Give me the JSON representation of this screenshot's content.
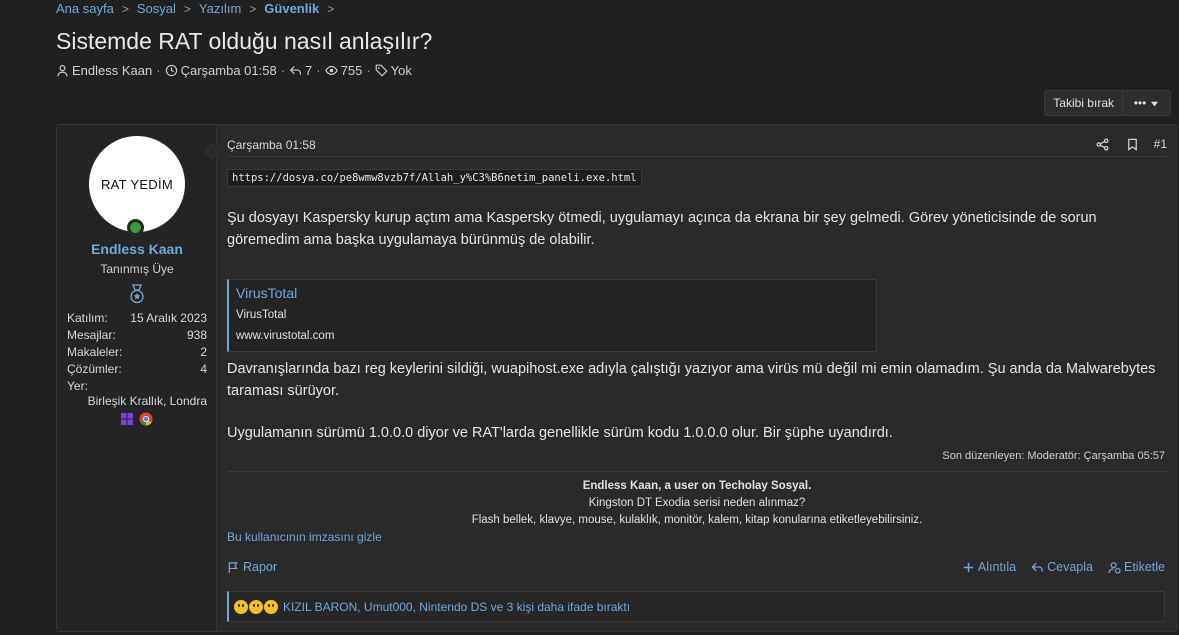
{
  "breadcrumb": [
    "Ana sayfa",
    "Sosyal",
    "Yazılım",
    "Güvenlik"
  ],
  "thread": {
    "title": "Sistemde RAT olduğu nasıl anlaşılır?",
    "author": "Endless Kaan",
    "date": "Çarşamba 01:58",
    "replies": "7",
    "views": "755",
    "tags": "Yok"
  },
  "top_actions": {
    "follow_label": "Takibi bırak",
    "more_label": "•••"
  },
  "user": {
    "avatar_text": "RAT YEDİM",
    "name": "Endless Kaan",
    "title": "Tanınmış Üye",
    "stats": [
      {
        "label": "Katılım:",
        "value": "15 Aralık 2023"
      },
      {
        "label": "Mesajlar:",
        "value": "938"
      },
      {
        "label": "Makaleler:",
        "value": "2"
      },
      {
        "label": "Çözümler:",
        "value": "4"
      },
      {
        "label": "Yer:",
        "value": ""
      }
    ],
    "location": "Birleşik Krallık, Londra"
  },
  "post": {
    "date": "Çarşamba 01:58",
    "number": "#1",
    "url": "https://dosya.co/pe8wmw8vzb7f/Allah_y%C3%B6netim_paneli.exe.html",
    "para1": "Şu dosyayı Kaspersky kurup açtım ama Kaspersky ötmedi, uygulamayı açınca da ekrana bir şey gelmedi. Görev yöneticisinde de sorun göremedim ama başka uygulamaya bürünmüş de olabilir.",
    "embed": {
      "title": "VirusTotal",
      "subtitle": "VirusTotal",
      "domain": "www.virustotal.com"
    },
    "para2": "Davranışlarında bazı reg keylerini sildiği, wuapihost.exe adıyla çalıştığı yazıyor ama virüs mü değil mi emin olamadım. Şu anda da Malwarebytes taraması sürüyor.",
    "para3": "Uygulamanın sürümü 1.0.0.0 diyor ve RAT'larda genellikle sürüm kodu 1.0.0.0 olur. Bir şüphe uyandırdı.",
    "edited": "Son düzenleyen: Moderatör: Çarşamba 05:57"
  },
  "signature": {
    "line1": "Endless Kaan, a user on Techolay Sosyal.",
    "line2": "Kingston DT Exodia serisi neden alınmaz?",
    "line3": "Flash bellek, klavye, mouse, kulaklık, monitör, kalem, kitap konularına etiketleyebilirsiniz.",
    "hide_label": "Bu kullanıcının imzasını gizle"
  },
  "actions": {
    "report": "Rapor",
    "quote": "Alıntıla",
    "reply": "Cevapla",
    "tag": "Etiketle"
  },
  "reactions": {
    "text": "KIZIL BARON, Umut000, Nintendo DS ve 3 kişi daha ifade bıraktı"
  },
  "colors": {
    "link": "#6ea8dc",
    "background": "#202020",
    "panel": "#2a2a2a",
    "online": "#3a9a3a"
  }
}
